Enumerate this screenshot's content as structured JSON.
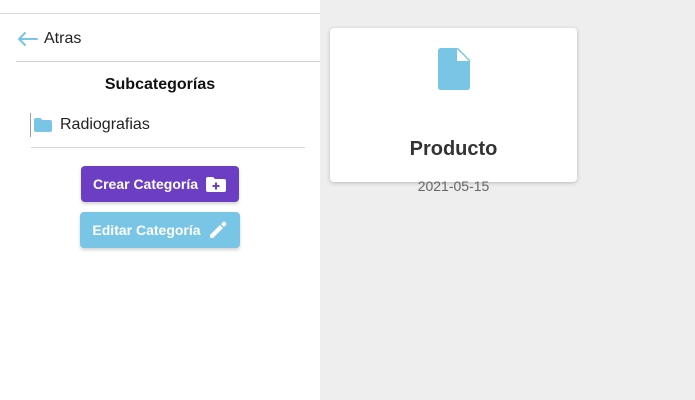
{
  "colors": {
    "primary": "#6c3ec4",
    "accent": "#79c5e6",
    "background": "#eeeeee",
    "panel": "#ffffff"
  },
  "nav": {
    "back_icon": "arrow-left-icon",
    "back_label": "Atras"
  },
  "sidebar": {
    "title": "Subcategorías",
    "items": [
      {
        "icon": "folder-icon",
        "label": "Radiografias"
      }
    ],
    "create_button": {
      "label": "Crear Categoría",
      "icon": "folder-plus-icon"
    },
    "edit_button": {
      "label": "Editar Categoría",
      "icon": "pencil-icon"
    }
  },
  "main": {
    "cards": [
      {
        "icon": "file-icon",
        "title": "Producto",
        "date": "2021-05-15"
      }
    ]
  }
}
